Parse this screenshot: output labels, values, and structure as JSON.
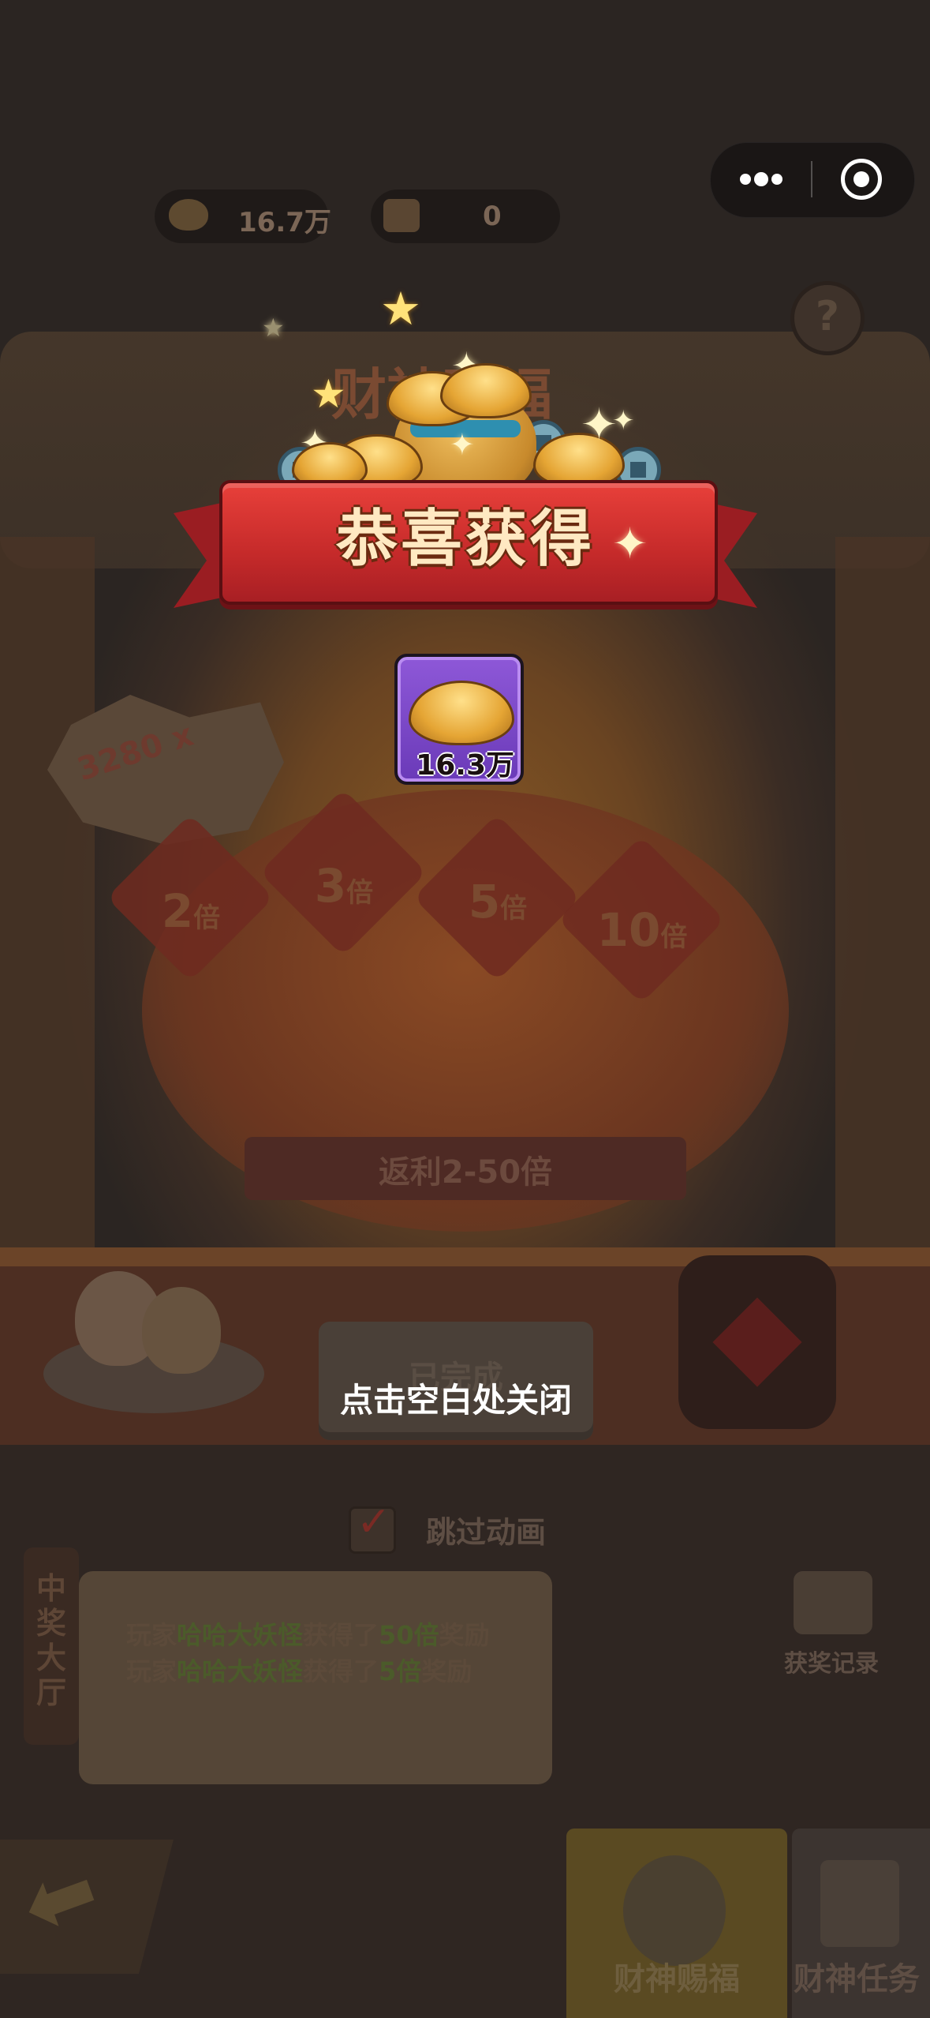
{
  "capsule": {
    "more_icon": "more-dots-icon",
    "close_icon": "target-close-icon"
  },
  "currency": {
    "gold_value": "16.7万",
    "gift_value": "0"
  },
  "background": {
    "banner_title": "财神赐福",
    "wheel_badge": "3280 x",
    "multipliers": [
      {
        "value": "2",
        "unit": "倍"
      },
      {
        "value": "3",
        "unit": "倍"
      },
      {
        "value": "5",
        "unit": "倍"
      },
      {
        "value": "10",
        "unit": "倍"
      }
    ],
    "rebate_text": "返利2-50倍",
    "done_button": "已完成",
    "skip_animation": "跳过动画",
    "hall_label": "中奖大厅",
    "announcements": [
      {
        "prefix": "玩家",
        "player": "哈哈大妖怪",
        "middle": "获得了",
        "mult": "50倍",
        "suffix": "奖励"
      },
      {
        "prefix": "玩家",
        "player": "哈哈大妖怪",
        "middle": "获得了",
        "mult": "5倍",
        "suffix": "奖励"
      }
    ],
    "records_label": "获奖记录",
    "tabs": {
      "active": "财神赐福",
      "other": "财神任务"
    }
  },
  "popup": {
    "title": "恭喜获得",
    "reward_amount": "16.3万",
    "close_hint": "点击空白处关闭"
  },
  "colors": {
    "ribbon": "#c52a2a",
    "card": "#7a46c8",
    "overlay": "#2b2522"
  }
}
